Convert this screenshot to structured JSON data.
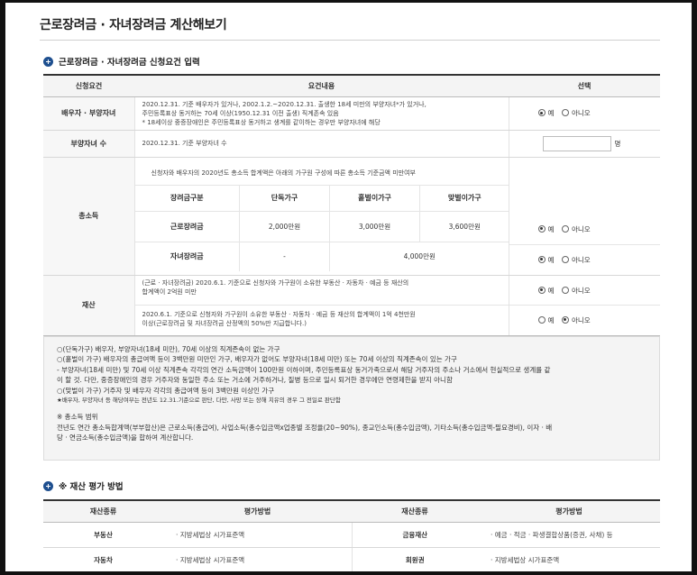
{
  "page": {
    "title": "근로장려금 · 자녀장려금 계산해보기"
  },
  "section1": {
    "title": "근로장려금 · 자녀장려금 신청요건 입력"
  },
  "table1": {
    "headers": [
      "신청요건",
      "요건내용",
      "선택"
    ],
    "spouse": {
      "label": "배우자 · 부양자녀",
      "line1": "2020.12.31. 기준 배우자가 있거나, 2002.1.2.~2020.12.31. 출생한 18세 미만의 부양자녀*가 있거나,",
      "line2": "주민등록표상 동거하는 70세 이상(1950.12.31 이전 출생) 직계존속 있음",
      "line3": "* 18세이상 중증장애인은 주민등록표상 동거하고 생계를 같이하는 경우만 부양자녀에 해당",
      "opt_yes": "예",
      "opt_no": "아니오"
    },
    "children": {
      "label": "부양자녀 수",
      "text": "2020.12.31. 기준 부양자녀 수",
      "value": "",
      "unit": "명"
    },
    "income": {
      "label": "총소득",
      "intro": "신청자와 배우자의 2020년도 총소득 합계액은 아래의 가구원 구성에 따른 총소득 기준금액 미만여부",
      "inner_headers": [
        "장려금구분",
        "단독가구",
        "홑벌이가구",
        "맞벌이가구"
      ],
      "row1": {
        "label": "근로장려금",
        "v1": "2,000만원",
        "v2": "3,000만원",
        "v3": "3,600만원"
      },
      "row2": {
        "label": "자녀장려금",
        "v1": "-",
        "v2": "4,000만원"
      },
      "opt_yes": "예",
      "opt_no": "아니오"
    },
    "property": {
      "label": "재산",
      "text1a": "(근로 · 자녀장려금) 2020.6.1. 기준으로 신청자와 가구원이 소유한 부동산 · 자동차 · 예금 등 재산의",
      "text1b": "합계액이 2억원 미만",
      "text2a": "2020.6.1. 기준으로 신청자와 가구원이 소유한 부동산 · 자동차 · 예금 등 재산의 합계액이 1억 4천만원",
      "text2b": "이상(근로장려금 및 자녀장려금 산정액의 50%만 지급합니다.)",
      "opt_yes": "예",
      "opt_no": "아니오"
    }
  },
  "notes": {
    "n1": "○(단독가구) 배우자, 부양자녀(18세 미만), 70세 이상의 직계존속이 없는 가구",
    "n2": "○(홑벌이 가구) 배우자의 총급여액 등이 3백만원 미만인 가구, 배우자가 없어도 부양자녀(18세 미만) 또는 70세 이상의 직계존속이 있는 가구",
    "n3": "- 부양자녀(18세 미만) 및 70세 이상 직계존속 각각의 연간 소득금액이 100만원 이하이며, 주민등록표상 동거가족으로서 해당 거주자의 주소나 거소에서 현실적으로 생계를 같",
    "n4": "이 할 것. 다만, 중증장애인의 경우 거주자와 동일한 주소 또는 거소에 거주하거나, 질병 등으로 일시 퇴거한 경우에만 연령제한을 받지 아니함",
    "n5": "○(맞벌이 가구) 거주자 및 배우자 각각의 총급여액 등이 3백만원 이상인 가구",
    "n6": "★배우자, 부양자녀 등 해당여부는 전년도 12.31.기준으로 판단, 다만, 사망 또는 장해 치유의 경우 그 전일로 판단함",
    "n7": "※ 총소득 범위",
    "n8": "전년도 연간 총소득합계액(부부합산)은 근로소득(총급여), 사업소득(총수입금액x업종별 조정율(20~90%), 종교인소득(총수입금액), 기타소득(총수입금액-필요경비), 이자 · 배",
    "n9": "당 · 연금소득(총수입금액)을 합하여 계산합니다."
  },
  "section2": {
    "title": "※ 재산 평가 방법"
  },
  "table2": {
    "headers": [
      "재산종류",
      "평가방법",
      "재산종류",
      "평가방법"
    ],
    "rows": [
      {
        "k1": "부동산",
        "v1": "· 지방세법상 시가표준액",
        "k2": "금융재산",
        "v2": "· 예금 · 적금 · 파생결합상품(증권, 사채) 등"
      },
      {
        "k1": "자동차",
        "v1": "· 지방세법상 시가표준액",
        "k2": "회원권",
        "v2": "· 지방세법상 시가표준액"
      }
    ]
  }
}
